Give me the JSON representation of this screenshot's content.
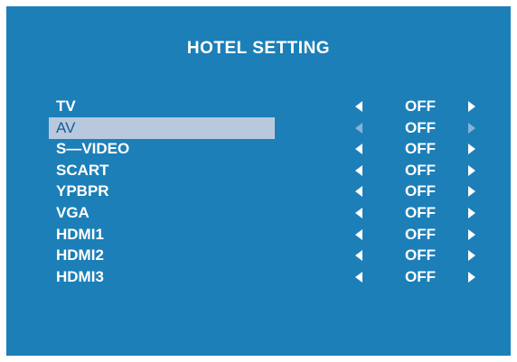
{
  "menu": {
    "title": "HOTEL SETTING",
    "selected_index": 1,
    "colors": {
      "background": "#1c7fb8",
      "text": "#ffffff",
      "highlight_bar": "#b8c9de",
      "selected_text": "#1b5a99",
      "dimmed_arrow": "#8ab3d8"
    },
    "icons": {
      "decrease": "triangle-left-icon",
      "increase": "triangle-right-icon"
    },
    "items": [
      {
        "label": "TV",
        "value": "OFF"
      },
      {
        "label": "AV",
        "value": "OFF"
      },
      {
        "label": "S—VIDEO",
        "value": "OFF"
      },
      {
        "label": "SCART",
        "value": "OFF"
      },
      {
        "label": "YPBPR",
        "value": "OFF"
      },
      {
        "label": "VGA",
        "value": "OFF"
      },
      {
        "label": "HDMI1",
        "value": "OFF"
      },
      {
        "label": "HDMI2",
        "value": "OFF"
      },
      {
        "label": "HDMI3",
        "value": "OFF"
      }
    ]
  }
}
